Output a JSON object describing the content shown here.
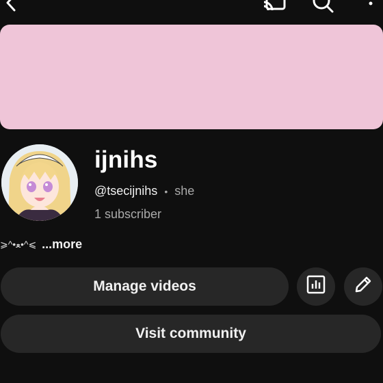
{
  "channel": {
    "name": "ijnihs",
    "handle": "@tsecijnihs",
    "separator": "•",
    "pronouns": "she",
    "subscribers": "1 subscriber",
    "bio_text": "⩾^•ﻌ•^⩽",
    "bio_more": "...more",
    "banner_color": "#efc5d8"
  },
  "actions": {
    "manage_label": "Manage videos",
    "community_label": "Visit community"
  },
  "icons": {
    "back": "back-icon",
    "cast": "cast-icon",
    "search": "search-icon",
    "more": "more-vert-icon",
    "analytics": "analytics-icon",
    "edit": "pencil-icon"
  }
}
